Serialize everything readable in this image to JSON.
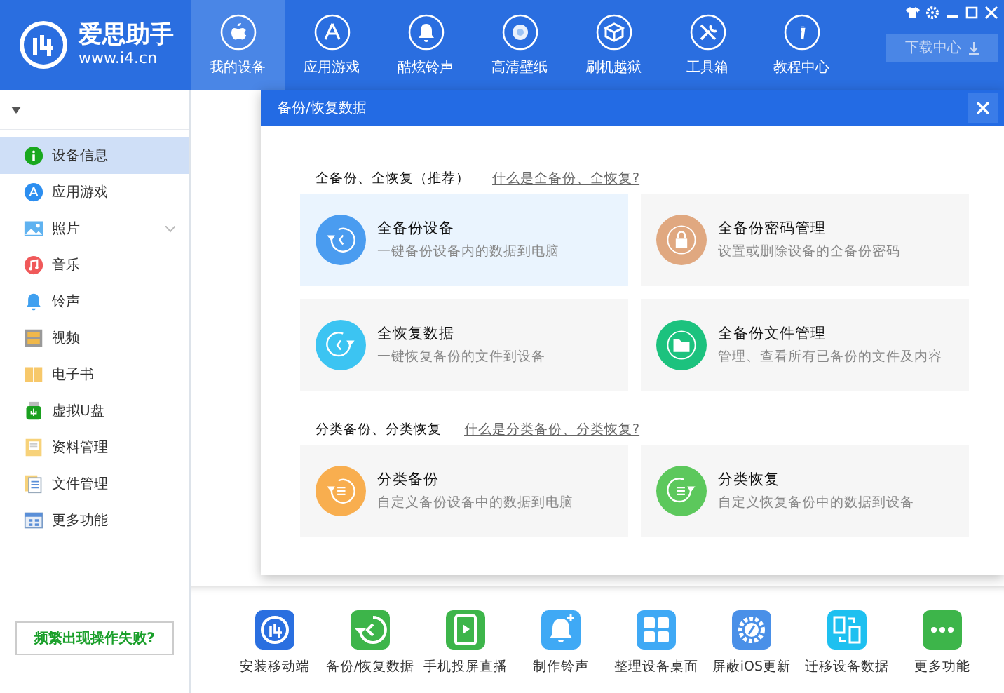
{
  "topbar": {
    "logo": {
      "name": "爱思助手",
      "url": "www.i4.cn"
    },
    "nav": [
      {
        "label": "我的设备",
        "selected": true
      },
      {
        "label": "应用游戏",
        "selected": false
      },
      {
        "label": "酷炫铃声",
        "selected": false
      },
      {
        "label": "高清壁纸",
        "selected": false
      },
      {
        "label": "刷机越狱",
        "selected": false
      },
      {
        "label": "工具箱",
        "selected": false
      },
      {
        "label": "教程中心",
        "selected": false
      }
    ],
    "download_button": {
      "label": "下载中心"
    }
  },
  "sidebar": {
    "items": [
      {
        "label": "设备信息",
        "selected": true,
        "expandable": false
      },
      {
        "label": "应用游戏",
        "selected": false,
        "expandable": false
      },
      {
        "label": "照片",
        "selected": false,
        "expandable": true
      },
      {
        "label": "音乐",
        "selected": false,
        "expandable": false
      },
      {
        "label": "铃声",
        "selected": false,
        "expandable": false
      },
      {
        "label": "视频",
        "selected": false,
        "expandable": false
      },
      {
        "label": "电子书",
        "selected": false,
        "expandable": false
      },
      {
        "label": "虚拟U盘",
        "selected": false,
        "expandable": false
      },
      {
        "label": "资料管理",
        "selected": false,
        "expandable": false
      },
      {
        "label": "文件管理",
        "selected": false,
        "expandable": false
      },
      {
        "label": "更多功能",
        "selected": false,
        "expandable": false
      }
    ],
    "help_button": {
      "label": "频繁出现操作失败?"
    }
  },
  "dialog": {
    "title": "备份/恢复数据",
    "sections": [
      {
        "title": "全备份、全恢复（推荐）",
        "link": "什么是全备份、全恢复?",
        "cards": [
          {
            "title": "全备份设备",
            "subtitle": "一键备份设备内的数据到电脑",
            "color": "#4a9cf0",
            "selected": true
          },
          {
            "title": "全备份密码管理",
            "subtitle": "设置或删除设备的全备份密码",
            "color": "#e0a880",
            "selected": false
          },
          {
            "title": "全恢复数据",
            "subtitle": "一键恢复备份的文件到设备",
            "color": "#3cc4f2",
            "selected": false
          },
          {
            "title": "全备份文件管理",
            "subtitle": "管理、查看所有已备份的文件及内容",
            "color": "#1cc27e",
            "selected": false
          }
        ]
      },
      {
        "title": "分类备份、分类恢复",
        "link": "什么是分类备份、分类恢复?",
        "cards": [
          {
            "title": "分类备份",
            "subtitle": "自定义备份设备中的数据到电脑",
            "color": "#f8ae4f",
            "selected": false
          },
          {
            "title": "分类恢复",
            "subtitle": "自定义恢复备份中的数据到设备",
            "color": "#5cc85c",
            "selected": false
          }
        ]
      }
    ]
  },
  "toolbar": {
    "items": [
      {
        "label": "安装移动端",
        "color": "#2a6fe0"
      },
      {
        "label": "备份/恢复数据",
        "color": "#3db54a"
      },
      {
        "label": "手机投屏直播",
        "color": "#3db54a"
      },
      {
        "label": "制作铃声",
        "color": "#3fa9f5"
      },
      {
        "label": "整理设备桌面",
        "color": "#3fa9f5"
      },
      {
        "label": "屏蔽iOS更新",
        "color": "#4a90e8"
      },
      {
        "label": "迁移设备数据",
        "color": "#1ec0f0"
      },
      {
        "label": "更多功能",
        "color": "#3db54a"
      }
    ]
  }
}
